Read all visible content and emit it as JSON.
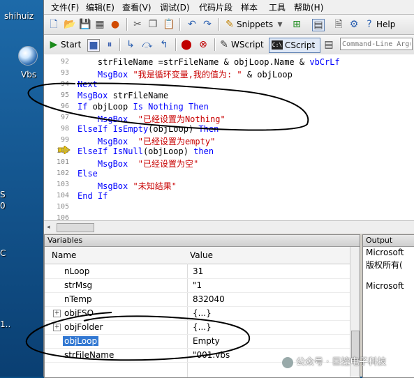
{
  "desktop": {
    "user_label": "shihuiz",
    "file_label": "Vbs",
    "frag1": "S",
    "frag2": "0",
    "frag3": "C",
    "frag4": "1.."
  },
  "menu": [
    "文件(F)",
    "编辑(E)",
    "查看(V)",
    "调试(D)",
    "代码片段",
    "样本",
    "工具",
    "帮助(H)"
  ],
  "toolbar1": {
    "snippets_label": "Snippets",
    "help_label": "Help"
  },
  "toolbar2": {
    "start_label": "Start",
    "wscript_label": "WScript",
    "cscript_label": "CScript",
    "cmdline_placeholder": "Command-Line Argu"
  },
  "editor": {
    "lines": [
      {
        "n": "92",
        "t": "    strFileName =strFileName & objLoop.Name & vbCrLf"
      },
      {
        "n": "93",
        "t": "    MsgBox \"我是循环变量,我的值为: \" & objLoop"
      },
      {
        "n": "94",
        "t": "Next"
      },
      {
        "n": "95",
        "t": "MsgBox strFileName"
      },
      {
        "n": "96",
        "t": "If objLoop Is Nothing Then"
      },
      {
        "n": "97",
        "t": "    MsgBox  \"已经设置为Nothing\""
      },
      {
        "n": "98",
        "t": "ElseIf IsEmpty(objLoop) Then"
      },
      {
        "n": "99",
        "t": "    MsgBox  \"已经设置为empty\""
      },
      {
        "n": "100",
        "t": "ElseIf IsNull(objLoop) then"
      },
      {
        "n": "101",
        "t": "    MsgBox  \"已经设置为空\""
      },
      {
        "n": "102",
        "t": "Else"
      },
      {
        "n": "103",
        "t": "    MsgBox \"未知结果\""
      },
      {
        "n": "104",
        "t": "End If"
      },
      {
        "n": "105",
        "t": ""
      },
      {
        "n": "106",
        "t": ""
      }
    ]
  },
  "variables": {
    "title": "Variables",
    "col_name": "Name",
    "col_value": "Value",
    "rows": [
      {
        "name": "nLoop",
        "value": "31"
      },
      {
        "name": "strMsg",
        "value": "\"1"
      },
      {
        "name": "nTemp",
        "value": "832040"
      },
      {
        "name": "objFSO",
        "value": "{...}"
      },
      {
        "name": "objFolder",
        "value": "{...}"
      },
      {
        "name": "objLoop",
        "value": "Empty"
      },
      {
        "name": "strFileName",
        "value": "\"001.vbs"
      }
    ]
  },
  "output": {
    "title": "Output",
    "line1": "Microsoft",
    "line2": "版权所有(",
    "line3": "Microsoft"
  },
  "watermark": "公众号 · 巨控电子科技"
}
